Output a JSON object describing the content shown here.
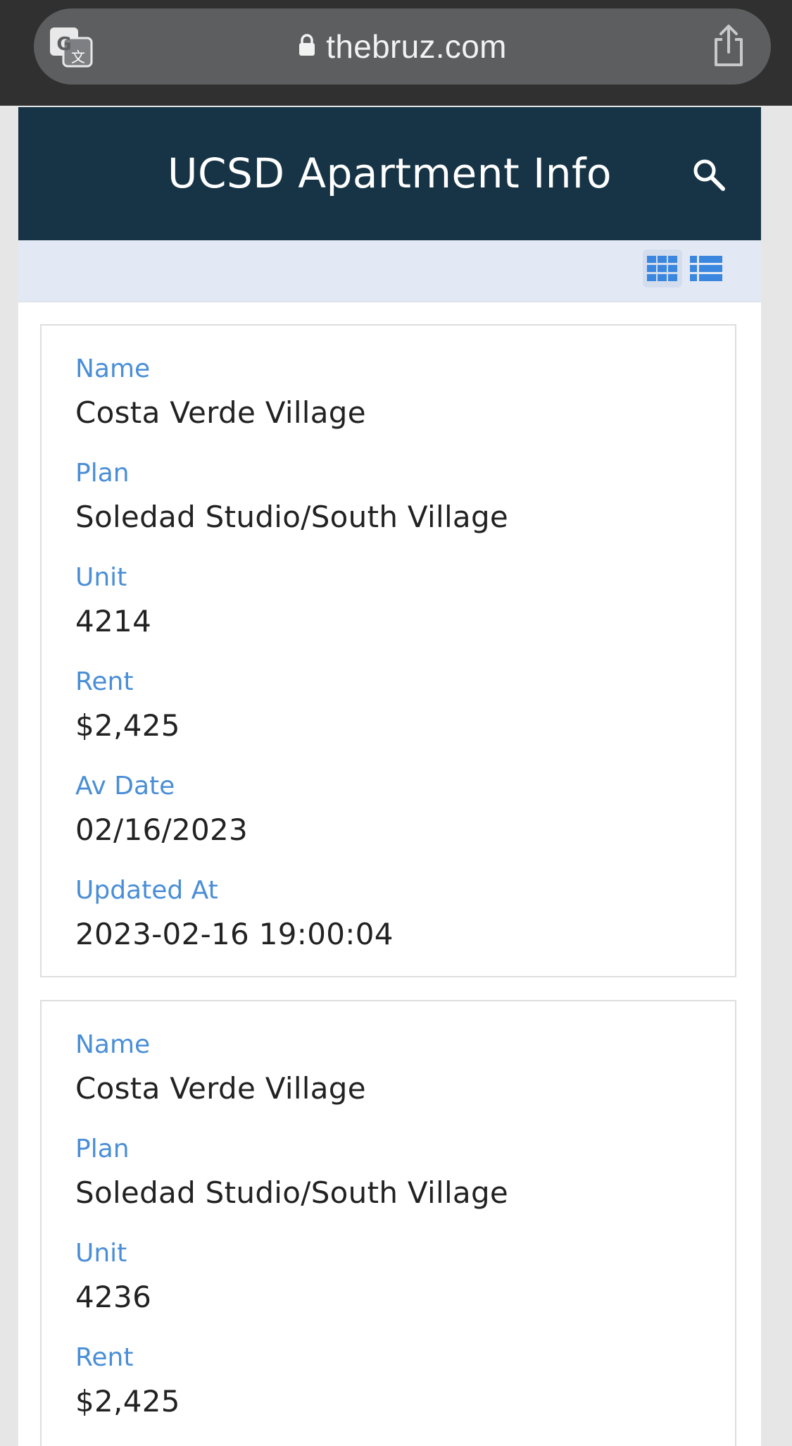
{
  "browser": {
    "url": "thebruz.com",
    "icons": {
      "translate": "translate-icon",
      "lock": "lock-icon",
      "share": "share-icon"
    }
  },
  "header": {
    "title": "UCSD Apartment Info",
    "search_icon": "search-icon",
    "background": "#173446"
  },
  "toolbar": {
    "grid_view_icon": "grid-view-icon",
    "list_view_icon": "list-view-icon",
    "active_view": "grid",
    "accent": "#4a8ed6"
  },
  "listings": [
    {
      "name_label": "Name",
      "name": "Costa Verde Village",
      "plan_label": "Plan",
      "plan": "Soledad Studio/South Village",
      "unit_label": "Unit",
      "unit": "4214",
      "rent_label": "Rent",
      "rent": "$2,425",
      "av_date_label": "Av Date",
      "av_date": "02/16/2023",
      "updated_label": "Updated At",
      "updated": "2023-02-16 19:00:04"
    },
    {
      "name_label": "Name",
      "name": "Costa Verde Village",
      "plan_label": "Plan",
      "plan": "Soledad Studio/South Village",
      "unit_label": "Unit",
      "unit": "4236",
      "rent_label": "Rent",
      "rent": "$2,425"
    }
  ]
}
